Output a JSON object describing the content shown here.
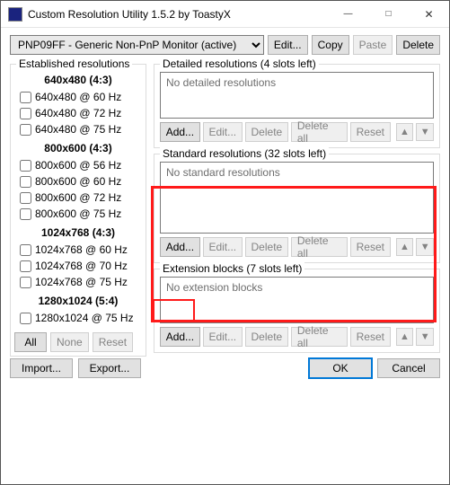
{
  "window_title": "Custom Resolution Utility 1.5.2 by ToastyX",
  "monitor_selected": "PNP09FF - Generic Non-PnP Monitor (active)",
  "top_buttons": {
    "edit": "Edit...",
    "copy": "Copy",
    "paste": "Paste",
    "delete": "Delete"
  },
  "left": {
    "legend": "Established resolutions",
    "groups": [
      {
        "head": "640x480 (4:3)",
        "items": [
          "640x480 @ 60 Hz",
          "640x480 @ 72 Hz",
          "640x480 @ 75 Hz"
        ]
      },
      {
        "head": "800x600 (4:3)",
        "items": [
          "800x600 @ 56 Hz",
          "800x600 @ 60 Hz",
          "800x600 @ 72 Hz",
          "800x600 @ 75 Hz"
        ]
      },
      {
        "head": "1024x768 (4:3)",
        "items": [
          "1024x768 @ 60 Hz",
          "1024x768 @ 70 Hz",
          "1024x768 @ 75 Hz"
        ]
      },
      {
        "head": "1280x1024 (5:4)",
        "items": [
          "1280x1024 @ 75 Hz"
        ]
      }
    ],
    "btn_all": "All",
    "btn_none": "None",
    "btn_reset": "Reset"
  },
  "sections": {
    "detailed": {
      "legend": "Detailed resolutions (4 slots left)",
      "placeholder": "No detailed resolutions"
    },
    "standard": {
      "legend": "Standard resolutions (32 slots left)",
      "placeholder": "No standard resolutions"
    },
    "extension": {
      "legend": "Extension blocks (7 slots left)",
      "placeholder": "No extension blocks"
    }
  },
  "sec_btns": {
    "add": "Add...",
    "edit": "Edit...",
    "delete": "Delete",
    "delete_all": "Delete all",
    "reset": "Reset"
  },
  "io": {
    "import": "Import...",
    "export": "Export..."
  },
  "footer": {
    "ok": "OK",
    "cancel": "Cancel"
  }
}
